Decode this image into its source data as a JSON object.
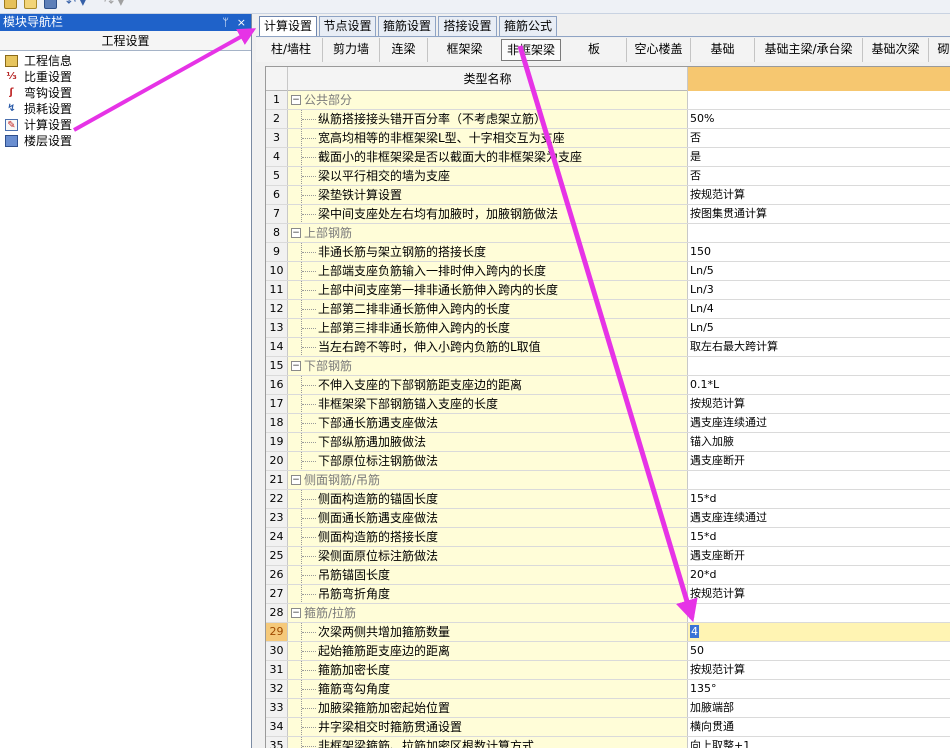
{
  "toolbar": {
    "icons": [
      "new-icon",
      "open-icon",
      "save-icon",
      "undo-icon",
      "redo-icon"
    ],
    "undo_glyph": "↶ ▾",
    "redo_glyph": "↷ ▾"
  },
  "nav": {
    "title": "模块导航栏",
    "pin": "ᛘ",
    "close": "×",
    "group": "工程设置",
    "items": [
      {
        "label": "工程信息",
        "icon": "project-info-icon"
      },
      {
        "label": "比重设置",
        "icon": "density-icon"
      },
      {
        "label": "弯钩设置",
        "icon": "hook-icon"
      },
      {
        "label": "损耗设置",
        "icon": "loss-icon"
      },
      {
        "label": "计算设置",
        "icon": "calc-settings-icon"
      },
      {
        "label": "楼层设置",
        "icon": "floor-settings-icon"
      }
    ]
  },
  "tabs1": [
    "计算设置",
    "节点设置",
    "箍筋设置",
    "搭接设置",
    "箍筋公式"
  ],
  "tabs2": [
    "柱/墙柱",
    "剪力墙",
    "连梁",
    "框架梁",
    "非框架梁",
    "板",
    "空心楼盖",
    "基础",
    "基础主梁/承台梁",
    "基础次梁",
    "砌"
  ],
  "grid": {
    "header_name": "类型名称",
    "rows": [
      {
        "n": "1",
        "name": "公共部分",
        "value": "",
        "group": true
      },
      {
        "n": "2",
        "name": "纵筋搭接接头错开百分率（不考虑架立筋）",
        "value": "50%"
      },
      {
        "n": "3",
        "name": "宽高均相等的非框架梁L型、十字相交互为支座",
        "value": "否"
      },
      {
        "n": "4",
        "name": "截面小的非框架梁是否以截面大的非框架梁为支座",
        "value": "是"
      },
      {
        "n": "5",
        "name": "梁以平行相交的墙为支座",
        "value": "否"
      },
      {
        "n": "6",
        "name": "梁垫铁计算设置",
        "value": "按规范计算"
      },
      {
        "n": "7",
        "name": "梁中间支座处左右均有加腋时，加腋钢筋做法",
        "value": "按图集贯通计算"
      },
      {
        "n": "8",
        "name": "上部钢筋",
        "value": "",
        "group": true
      },
      {
        "n": "9",
        "name": "非通长筋与架立钢筋的搭接长度",
        "value": "150"
      },
      {
        "n": "10",
        "name": "上部端支座负筋输入一排时伸入跨内的长度",
        "value": "Ln/5"
      },
      {
        "n": "11",
        "name": "上部中间支座第一排非通长筋伸入跨内的长度",
        "value": "Ln/3"
      },
      {
        "n": "12",
        "name": "上部第二排非通长筋伸入跨内的长度",
        "value": "Ln/4"
      },
      {
        "n": "13",
        "name": "上部第三排非通长筋伸入跨内的长度",
        "value": "Ln/5"
      },
      {
        "n": "14",
        "name": "当左右跨不等时，伸入小跨内负筋的L取值",
        "value": "取左右最大跨计算"
      },
      {
        "n": "15",
        "name": "下部钢筋",
        "value": "",
        "group": true
      },
      {
        "n": "16",
        "name": "不伸入支座的下部钢筋距支座边的距离",
        "value": "0.1*L"
      },
      {
        "n": "17",
        "name": "非框架梁下部钢筋锚入支座的长度",
        "value": "按规范计算"
      },
      {
        "n": "18",
        "name": "下部通长筋遇支座做法",
        "value": "遇支座连续通过"
      },
      {
        "n": "19",
        "name": "下部纵筋遇加腋做法",
        "value": "锚入加腋"
      },
      {
        "n": "20",
        "name": "下部原位标注钢筋做法",
        "value": "遇支座断开"
      },
      {
        "n": "21",
        "name": "侧面钢筋/吊筋",
        "value": "",
        "group": true
      },
      {
        "n": "22",
        "name": "侧面构造筋的锚固长度",
        "value": "15*d"
      },
      {
        "n": "23",
        "name": "侧面通长筋遇支座做法",
        "value": "遇支座连续通过"
      },
      {
        "n": "24",
        "name": "侧面构造筋的搭接长度",
        "value": "15*d"
      },
      {
        "n": "25",
        "name": "梁侧面原位标注筋做法",
        "value": "遇支座断开"
      },
      {
        "n": "26",
        "name": "吊筋锚固长度",
        "value": "20*d"
      },
      {
        "n": "27",
        "name": "吊筋弯折角度",
        "value": "按规范计算"
      },
      {
        "n": "28",
        "name": "箍筋/拉筋",
        "value": "",
        "group": true
      },
      {
        "n": "29",
        "name": "次梁两侧共增加箍筋数量",
        "value": "4",
        "selected": true
      },
      {
        "n": "30",
        "name": "起始箍筋距支座边的距离",
        "value": "50"
      },
      {
        "n": "31",
        "name": "箍筋加密长度",
        "value": "按规范计算"
      },
      {
        "n": "32",
        "name": "箍筋弯勾角度",
        "value": "135°"
      },
      {
        "n": "33",
        "name": "加腋梁箍筋加密起始位置",
        "value": "加腋端部"
      },
      {
        "n": "34",
        "name": "井字梁相交时箍筋贯通设置",
        "value": "横向贯通"
      },
      {
        "n": "35",
        "name": "非框架梁箍筋、拉筋加密区根数计算方式",
        "value": "向上取整+1"
      }
    ]
  },
  "colors": {
    "nav_header": "#1f62c9",
    "name_cell": "#fffdd8",
    "value_header": "#f6c770",
    "arrow": "#e633e6"
  }
}
